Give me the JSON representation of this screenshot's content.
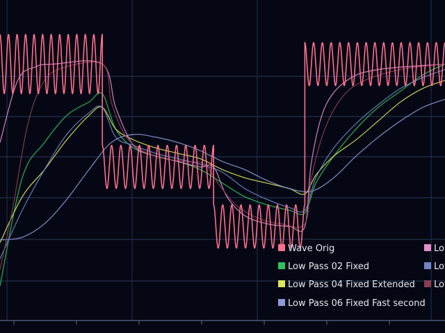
{
  "chart_data": {
    "type": "line",
    "grid": true,
    "legend_position": "bottom-right",
    "xlim": [
      0,
      100
    ],
    "ylim": [
      0,
      100
    ],
    "series": [
      {
        "name": "Wave Orig",
        "color": "#ff6f8c",
        "style": "oscillating",
        "segments": [
          {
            "x0": 0.0,
            "x1": 23.0,
            "center": 84.0,
            "amplitude": 11.0,
            "cycles": 12
          },
          {
            "x0": 23.0,
            "x1": 48.0,
            "center": 46.0,
            "amplitude": 8.0,
            "cycles": 12
          },
          {
            "x0": 48.0,
            "x1": 68.5,
            "center": 24.0,
            "amplitude": 8.0,
            "cycles": 10
          },
          {
            "x0": 68.5,
            "x1": 100.0,
            "center": 84.0,
            "amplitude": 8.0,
            "cycles": 16
          }
        ]
      },
      {
        "name": "Low Pass 02 Fixed",
        "color": "#2fc25b",
        "style": "smooth",
        "points": [
          [
            0,
            2
          ],
          [
            5,
            42
          ],
          [
            10,
            55
          ],
          [
            15,
            65
          ],
          [
            20,
            70
          ],
          [
            23,
            73
          ],
          [
            26,
            60
          ],
          [
            30,
            53
          ],
          [
            35,
            50
          ],
          [
            40,
            48
          ],
          [
            45,
            45
          ],
          [
            50,
            40
          ],
          [
            55,
            35
          ],
          [
            60,
            32
          ],
          [
            65,
            30
          ],
          [
            68.5,
            29
          ],
          [
            71,
            40
          ],
          [
            75,
            50
          ],
          [
            80,
            60
          ],
          [
            85,
            68
          ],
          [
            90,
            74
          ],
          [
            95,
            80
          ],
          [
            100,
            84
          ]
        ]
      },
      {
        "name": "Low Pass 04 Fixed Extended",
        "color": "#dde65a",
        "style": "smooth",
        "points": [
          [
            0,
            18
          ],
          [
            5,
            35
          ],
          [
            10,
            45
          ],
          [
            15,
            56
          ],
          [
            20,
            65
          ],
          [
            23,
            68
          ],
          [
            26,
            60
          ],
          [
            30,
            56
          ],
          [
            35,
            53
          ],
          [
            40,
            51
          ],
          [
            45,
            49
          ],
          [
            50,
            45
          ],
          [
            55,
            42
          ],
          [
            60,
            40
          ],
          [
            65,
            38
          ],
          [
            68.5,
            36
          ],
          [
            71,
            43
          ],
          [
            75,
            50
          ],
          [
            80,
            56
          ],
          [
            85,
            63
          ],
          [
            90,
            70
          ],
          [
            95,
            75
          ],
          [
            100,
            78
          ]
        ]
      },
      {
        "name": "Low Pass 06 Fixed Fast second",
        "color": "#8f9ad6",
        "style": "smooth",
        "points": [
          [
            0,
            19
          ],
          [
            5,
            20
          ],
          [
            10,
            25
          ],
          [
            15,
            34
          ],
          [
            20,
            45
          ],
          [
            25,
            55
          ],
          [
            30,
            58
          ],
          [
            35,
            57
          ],
          [
            40,
            55
          ],
          [
            45,
            52
          ],
          [
            50,
            48
          ],
          [
            55,
            45
          ],
          [
            60,
            41
          ],
          [
            65,
            38
          ],
          [
            70,
            37
          ],
          [
            75,
            42
          ],
          [
            80,
            50
          ],
          [
            85,
            57
          ],
          [
            90,
            63
          ],
          [
            95,
            68
          ],
          [
            100,
            71
          ]
        ]
      },
      {
        "name": "Low",
        "color": "#e48ec8",
        "style": "smooth",
        "points": [
          [
            0,
            55
          ],
          [
            4,
            78
          ],
          [
            8,
            83
          ],
          [
            12,
            84
          ],
          [
            23,
            84
          ],
          [
            26,
            68
          ],
          [
            30,
            54
          ],
          [
            35,
            50
          ],
          [
            40,
            48
          ],
          [
            45,
            46
          ],
          [
            48,
            46
          ],
          [
            51,
            35
          ],
          [
            55,
            28
          ],
          [
            60,
            25
          ],
          [
            65,
            24
          ],
          [
            68.5,
            24
          ],
          [
            70,
            48
          ],
          [
            73,
            68
          ],
          [
            78,
            78
          ],
          [
            85,
            82
          ],
          [
            100,
            84
          ]
        ]
      },
      {
        "name": "Low",
        "color": "#6f86c6",
        "style": "smooth",
        "points": [
          [
            0,
            12
          ],
          [
            5,
            30
          ],
          [
            10,
            45
          ],
          [
            15,
            58
          ],
          [
            20,
            66
          ],
          [
            23,
            68
          ],
          [
            26,
            57
          ],
          [
            30,
            54
          ],
          [
            35,
            51
          ],
          [
            40,
            49
          ],
          [
            45,
            47
          ],
          [
            50,
            44
          ],
          [
            55,
            38
          ],
          [
            60,
            34
          ],
          [
            65,
            31
          ],
          [
            68.5,
            30
          ],
          [
            71,
            42
          ],
          [
            75,
            53
          ],
          [
            80,
            62
          ],
          [
            85,
            69
          ],
          [
            90,
            75
          ],
          [
            95,
            79
          ],
          [
            100,
            82
          ]
        ]
      },
      {
        "name": "Low",
        "color": "#8a3d52",
        "style": "smooth",
        "points": [
          [
            0,
            8
          ],
          [
            3,
            32
          ],
          [
            6,
            60
          ],
          [
            9,
            75
          ],
          [
            13,
            82
          ],
          [
            23,
            84
          ],
          [
            25,
            70
          ],
          [
            28,
            58
          ],
          [
            32,
            52
          ],
          [
            37,
            49
          ],
          [
            42,
            48
          ],
          [
            46,
            47
          ],
          [
            49,
            40
          ],
          [
            53,
            32
          ],
          [
            58,
            27
          ],
          [
            63,
            25
          ],
          [
            68.5,
            25
          ],
          [
            70,
            42
          ],
          [
            73,
            60
          ],
          [
            77,
            72
          ],
          [
            82,
            78
          ],
          [
            90,
            82
          ],
          [
            100,
            84
          ]
        ]
      }
    ]
  }
}
